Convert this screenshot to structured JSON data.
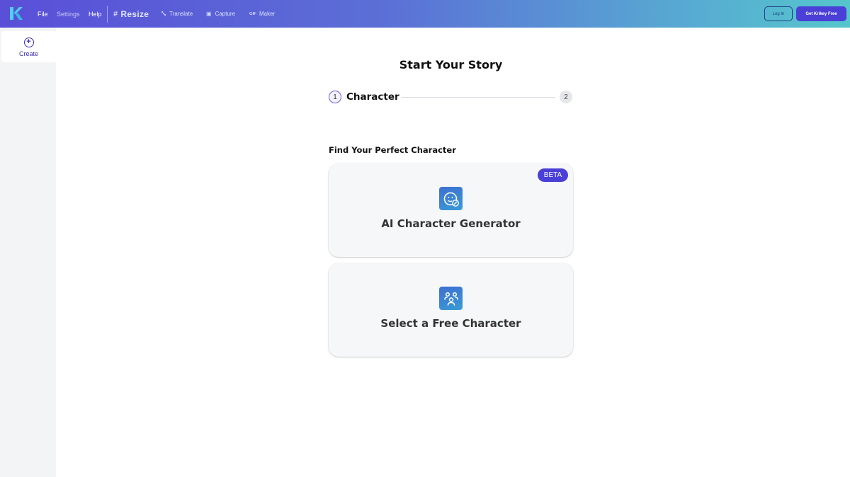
{
  "header": {
    "logo_icon": "k-logo-icon",
    "menu": {
      "file": "File",
      "settings": "Settings",
      "help": "Help"
    },
    "tools": {
      "resize": "Resize",
      "resize_icon": "#",
      "translate": "Translate",
      "translate_icon": "translate-icon",
      "capture": "Capture",
      "capture_icon": "camera-icon",
      "gif_maker": "Maker",
      "gif_prefix": "GIF"
    },
    "login_label": "Log In",
    "get_free_label": "Get Krikey Free",
    "colors": {
      "gradient_start": "#5a4fd8",
      "gradient_end": "#55c6cc",
      "accent": "#4a3fd6"
    }
  },
  "sidebar": {
    "items": [
      {
        "label": "Create",
        "icon": "plus-circle-icon"
      }
    ]
  },
  "main": {
    "title": "Start Your Story",
    "stepper": {
      "step1_number": "1",
      "step1_label": "Character",
      "step2_number": "2"
    },
    "subheading": "Find Your Perfect Character",
    "cards": [
      {
        "label": "AI Character Generator",
        "icon": "face-edit-icon",
        "badge": "BETA"
      },
      {
        "label": "Select a Free Character",
        "icon": "characters-icon"
      }
    ]
  }
}
